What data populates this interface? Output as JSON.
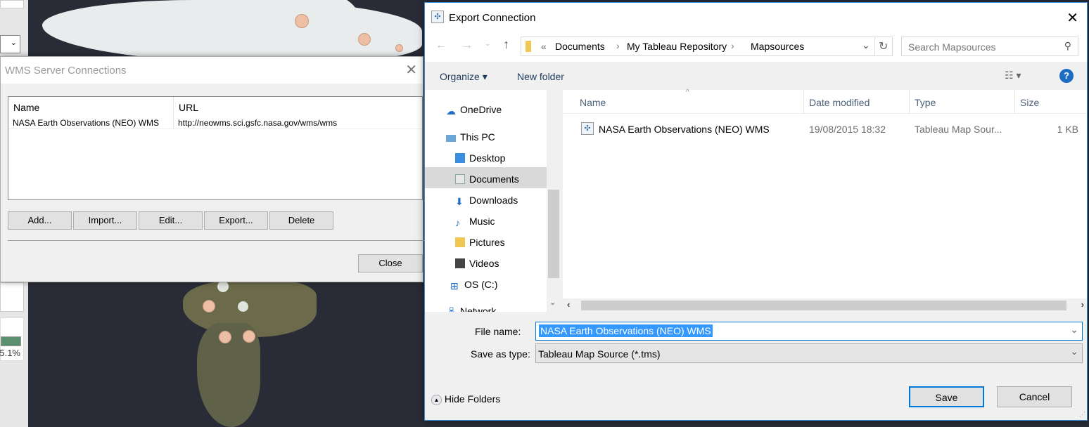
{
  "background": {
    "progress_label": "5.1%"
  },
  "wms": {
    "title": "WMS Server Connections",
    "columns": [
      "Name",
      "URL"
    ],
    "rows": [
      {
        "name": "NASA Earth Observations (NEO) WMS",
        "url": "http://neowms.sci.gsfc.nasa.gov/wms/wms"
      }
    ],
    "buttons": {
      "add": "Add...",
      "import": "Import...",
      "edit": "Edit...",
      "export": "Export...",
      "delete": "Delete",
      "close": "Close"
    }
  },
  "export": {
    "title": "Export Connection",
    "breadcrumb": {
      "overflow": "«",
      "items": [
        "Documents",
        "My Tableau Repository",
        "Mapsources"
      ]
    },
    "search_placeholder": "Search Mapsources",
    "toolbar": {
      "organize": "Organize",
      "new_folder": "New folder",
      "help": "?"
    },
    "nav": [
      "OneDrive",
      "This PC",
      "Desktop",
      "Documents",
      "Downloads",
      "Music",
      "Pictures",
      "Videos",
      "OS (C:)",
      "Network"
    ],
    "columns": [
      "Name",
      "Date modified",
      "Type",
      "Size"
    ],
    "files": [
      {
        "name": "NASA Earth Observations (NEO) WMS",
        "date": "19/08/2015 18:32",
        "type": "Tableau Map Sour...",
        "size": "1 KB"
      }
    ],
    "file_name_label": "File name:",
    "file_name": "NASA Earth Observations (NEO) WMS",
    "save_type_label": "Save as type:",
    "save_type": "Tableau Map Source (*.tms)",
    "hide_folders": "Hide Folders",
    "save": "Save",
    "cancel": "Cancel"
  },
  "colors": {
    "accent": "#0078d7",
    "selection": "#3399ff"
  }
}
